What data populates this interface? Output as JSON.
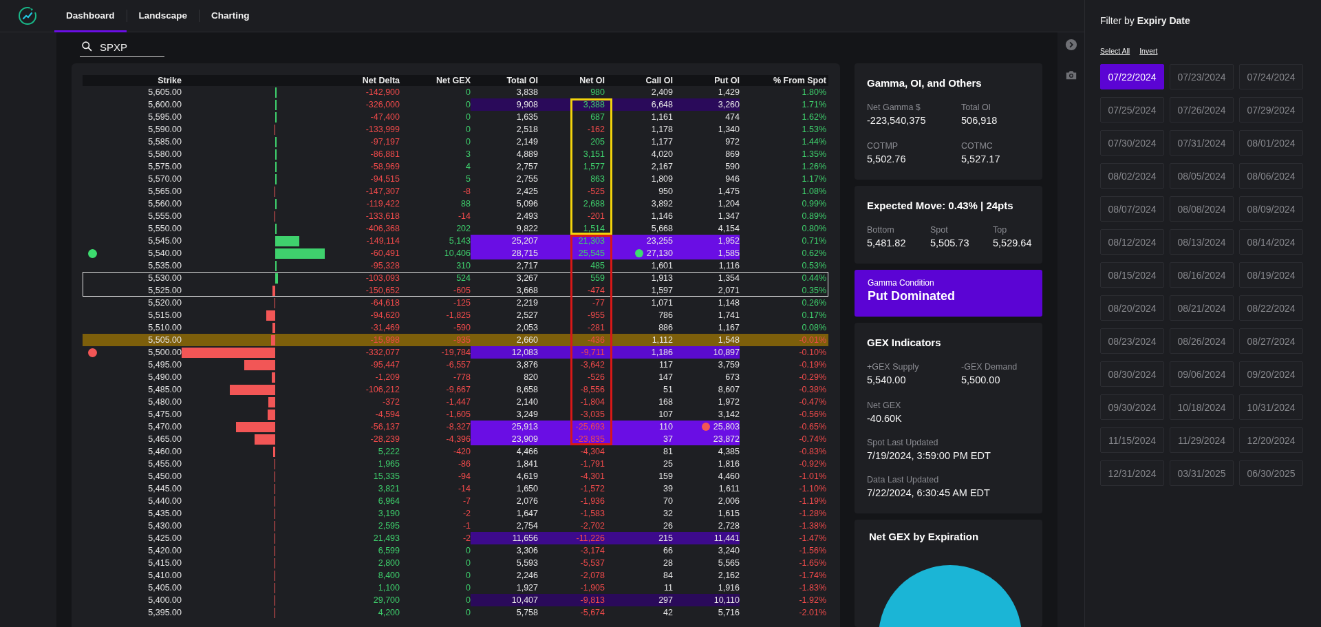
{
  "nav": {
    "tabs": [
      {
        "label": "Dashboard",
        "selected": true
      },
      {
        "label": "Landscape",
        "selected": false
      },
      {
        "label": "Charting",
        "selected": false
      }
    ]
  },
  "search": {
    "value": "SPXP"
  },
  "table": {
    "columns": [
      "Strike",
      "Net Delta",
      "Net GEX",
      "Total OI",
      "Net OI",
      "Call OI",
      "Put OI",
      "% From Spot"
    ],
    "rows": [
      {
        "strike": "5,605.00",
        "net_delta": "-142,900",
        "net_gex": "0",
        "total_oi": "3,838",
        "net_oi": "980",
        "call_oi": "2,409",
        "put_oi": "1,429",
        "from_spot": "1.80%",
        "in_range": false,
        "at_spot": false
      },
      {
        "strike": "5,600.00",
        "net_delta": "-326,000",
        "net_gex": "0",
        "total_oi": "9,908",
        "net_oi": "3,388",
        "call_oi": "6,648",
        "put_oi": "3,260",
        "from_spot": "1.71%",
        "in_range": false,
        "at_spot": false,
        "highlight": {
          "kind": "faint"
        },
        "net_oi_box": {
          "kind": "call"
        }
      },
      {
        "strike": "5,595.00",
        "net_delta": "-47,400",
        "net_gex": "0",
        "total_oi": "1,635",
        "net_oi": "687",
        "call_oi": "1,161",
        "put_oi": "474",
        "from_spot": "1.62%",
        "in_range": false,
        "at_spot": false,
        "net_oi_box": {
          "kind": "call"
        }
      },
      {
        "strike": "5,590.00",
        "net_delta": "-133,999",
        "net_gex": "0",
        "total_oi": "2,518",
        "net_oi": "-162",
        "call_oi": "1,178",
        "put_oi": "1,340",
        "from_spot": "1.53%",
        "in_range": false,
        "at_spot": false,
        "net_oi_box": {
          "kind": "call"
        }
      },
      {
        "strike": "5,585.00",
        "net_delta": "-97,197",
        "net_gex": "0",
        "total_oi": "2,149",
        "net_oi": "205",
        "call_oi": "1,177",
        "put_oi": "972",
        "from_spot": "1.44%",
        "in_range": false,
        "at_spot": false,
        "net_oi_box": {
          "kind": "call"
        }
      },
      {
        "strike": "5,580.00",
        "net_delta": "-86,881",
        "net_gex": "3",
        "total_oi": "4,889",
        "net_oi": "3,151",
        "call_oi": "4,020",
        "put_oi": "869",
        "from_spot": "1.35%",
        "in_range": false,
        "at_spot": false,
        "net_oi_box": {
          "kind": "call"
        }
      },
      {
        "strike": "5,575.00",
        "net_delta": "-58,969",
        "net_gex": "4",
        "total_oi": "2,757",
        "net_oi": "1,577",
        "call_oi": "2,167",
        "put_oi": "590",
        "from_spot": "1.26%",
        "in_range": false,
        "at_spot": false,
        "net_oi_box": {
          "kind": "call"
        }
      },
      {
        "strike": "5,570.00",
        "net_delta": "-94,515",
        "net_gex": "5",
        "total_oi": "2,755",
        "net_oi": "863",
        "call_oi": "1,809",
        "put_oi": "946",
        "from_spot": "1.17%",
        "in_range": false,
        "at_spot": false,
        "net_oi_box": {
          "kind": "call"
        }
      },
      {
        "strike": "5,565.00",
        "net_delta": "-147,307",
        "net_gex": "-8",
        "total_oi": "2,425",
        "net_oi": "-525",
        "call_oi": "950",
        "put_oi": "1,475",
        "from_spot": "1.08%",
        "in_range": false,
        "at_spot": false,
        "net_oi_box": {
          "kind": "call"
        }
      },
      {
        "strike": "5,560.00",
        "net_delta": "-119,422",
        "net_gex": "88",
        "total_oi": "5,096",
        "net_oi": "2,688",
        "call_oi": "3,892",
        "put_oi": "1,204",
        "from_spot": "0.99%",
        "in_range": false,
        "at_spot": false,
        "net_oi_box": {
          "kind": "call"
        }
      },
      {
        "strike": "5,555.00",
        "net_delta": "-133,618",
        "net_gex": "-14",
        "total_oi": "2,493",
        "net_oi": "-201",
        "call_oi": "1,146",
        "put_oi": "1,347",
        "from_spot": "0.89%",
        "in_range": false,
        "at_spot": false,
        "net_oi_box": {
          "kind": "call"
        }
      },
      {
        "strike": "5,550.00",
        "net_delta": "-406,368",
        "net_gex": "202",
        "total_oi": "9,822",
        "net_oi": "1,514",
        "call_oi": "5,668",
        "put_oi": "4,154",
        "from_spot": "0.80%",
        "in_range": false,
        "at_spot": false,
        "net_oi_box": {
          "kind": "call"
        }
      },
      {
        "strike": "5,545.00",
        "net_delta": "-149,114",
        "net_gex": "5,143",
        "total_oi": "25,207",
        "net_oi": "21,303",
        "call_oi": "23,255",
        "put_oi": "1,952",
        "from_spot": "0.71%",
        "in_range": false,
        "at_spot": false,
        "highlight": {
          "kind": "high"
        },
        "net_oi_box": {
          "kind": "put"
        }
      },
      {
        "strike": "5,540.00",
        "net_delta": "-60,491",
        "net_gex": "10,406",
        "total_oi": "28,715",
        "net_oi": "25,545",
        "call_oi": "27,130",
        "put_oi": "1,585",
        "from_spot": "0.62%",
        "in_range": false,
        "at_spot": false,
        "highlight": {
          "kind": "high"
        },
        "net_oi_box": {
          "kind": "put"
        },
        "row_dot": {
          "color": "#3ddc6f"
        },
        "cell_dot": {
          "kind": "call",
          "color": "#3ddc6f"
        }
      },
      {
        "strike": "5,535.00",
        "net_delta": "-95,328",
        "net_gex": "310",
        "total_oi": "2,717",
        "net_oi": "485",
        "call_oi": "1,601",
        "put_oi": "1,116",
        "from_spot": "0.53%",
        "in_range": false,
        "at_spot": false,
        "net_oi_box": {
          "kind": "put"
        }
      },
      {
        "strike": "5,530.00",
        "net_delta": "-103,093",
        "net_gex": "524",
        "total_oi": "3,267",
        "net_oi": "559",
        "call_oi": "1,913",
        "put_oi": "1,354",
        "from_spot": "0.44%",
        "in_range": true,
        "at_spot": false,
        "net_oi_box": {
          "kind": "put"
        }
      },
      {
        "strike": "5,525.00",
        "net_delta": "-150,652",
        "net_gex": "-605",
        "total_oi": "3,668",
        "net_oi": "-474",
        "call_oi": "1,597",
        "put_oi": "2,071",
        "from_spot": "0.35%",
        "in_range": true,
        "at_spot": false,
        "net_oi_box": {
          "kind": "put"
        }
      },
      {
        "strike": "5,520.00",
        "net_delta": "-64,618",
        "net_gex": "-125",
        "total_oi": "2,219",
        "net_oi": "-77",
        "call_oi": "1,071",
        "put_oi": "1,148",
        "from_spot": "0.26%",
        "in_range": false,
        "at_spot": false,
        "net_oi_box": {
          "kind": "put"
        }
      },
      {
        "strike": "5,515.00",
        "net_delta": "-94,620",
        "net_gex": "-1,825",
        "total_oi": "2,527",
        "net_oi": "-955",
        "call_oi": "786",
        "put_oi": "1,741",
        "from_spot": "0.17%",
        "in_range": false,
        "at_spot": false,
        "net_oi_box": {
          "kind": "put"
        }
      },
      {
        "strike": "5,510.00",
        "net_delta": "-31,469",
        "net_gex": "-590",
        "total_oi": "2,053",
        "net_oi": "-281",
        "call_oi": "886",
        "put_oi": "1,167",
        "from_spot": "0.08%",
        "in_range": false,
        "at_spot": false,
        "net_oi_box": {
          "kind": "put"
        }
      },
      {
        "strike": "5,505.00",
        "net_delta": "-15,998",
        "net_gex": "-935",
        "total_oi": "2,660",
        "net_oi": "-436",
        "call_oi": "1,112",
        "put_oi": "1,548",
        "from_spot": "-0.01%",
        "in_range": false,
        "at_spot": true,
        "net_oi_box": {
          "kind": "put"
        }
      },
      {
        "strike": "5,500.00",
        "net_delta": "-332,077",
        "net_gex": "-19,784",
        "total_oi": "12,083",
        "net_oi": "-9,711",
        "call_oi": "1,186",
        "put_oi": "10,897",
        "from_spot": "-0.10%",
        "in_range": false,
        "at_spot": false,
        "highlight": {
          "kind": "medium"
        },
        "net_oi_box": {
          "kind": "put"
        },
        "row_dot": {
          "color": "#f25656"
        }
      },
      {
        "strike": "5,495.00",
        "net_delta": "-95,447",
        "net_gex": "-6,557",
        "total_oi": "3,876",
        "net_oi": "-3,642",
        "call_oi": "117",
        "put_oi": "3,759",
        "from_spot": "-0.19%",
        "in_range": false,
        "at_spot": false,
        "net_oi_box": {
          "kind": "put"
        }
      },
      {
        "strike": "5,490.00",
        "net_delta": "-1,209",
        "net_gex": "-778",
        "total_oi": "820",
        "net_oi": "-526",
        "call_oi": "147",
        "put_oi": "673",
        "from_spot": "-0.29%",
        "in_range": false,
        "at_spot": false,
        "net_oi_box": {
          "kind": "put"
        }
      },
      {
        "strike": "5,485.00",
        "net_delta": "-106,212",
        "net_gex": "-9,667",
        "total_oi": "8,658",
        "net_oi": "-8,556",
        "call_oi": "51",
        "put_oi": "8,607",
        "from_spot": "-0.38%",
        "in_range": false,
        "at_spot": false,
        "net_oi_box": {
          "kind": "put"
        }
      },
      {
        "strike": "5,480.00",
        "net_delta": "-372",
        "net_gex": "-1,447",
        "total_oi": "2,140",
        "net_oi": "-1,804",
        "call_oi": "168",
        "put_oi": "1,972",
        "from_spot": "-0.47%",
        "in_range": false,
        "at_spot": false,
        "net_oi_box": {
          "kind": "put"
        }
      },
      {
        "strike": "5,475.00",
        "net_delta": "-4,594",
        "net_gex": "-1,605",
        "total_oi": "3,249",
        "net_oi": "-3,035",
        "call_oi": "107",
        "put_oi": "3,142",
        "from_spot": "-0.56%",
        "in_range": false,
        "at_spot": false,
        "net_oi_box": {
          "kind": "put"
        }
      },
      {
        "strike": "5,470.00",
        "net_delta": "-56,137",
        "net_gex": "-8,327",
        "total_oi": "25,913",
        "net_oi": "-25,693",
        "call_oi": "110",
        "put_oi": "25,803",
        "from_spot": "-0.65%",
        "in_range": false,
        "at_spot": false,
        "highlight": {
          "kind": "high"
        },
        "net_oi_box": {
          "kind": "put"
        },
        "cell_dot": {
          "kind": "put",
          "color": "#f25656"
        }
      },
      {
        "strike": "5,465.00",
        "net_delta": "-28,239",
        "net_gex": "-4,396",
        "total_oi": "23,909",
        "net_oi": "-23,835",
        "call_oi": "37",
        "put_oi": "23,872",
        "from_spot": "-0.74%",
        "in_range": false,
        "at_spot": false,
        "highlight": {
          "kind": "high"
        },
        "net_oi_box": {
          "kind": "put"
        }
      },
      {
        "strike": "5,460.00",
        "net_delta": "5,222",
        "net_gex": "-420",
        "total_oi": "4,466",
        "net_oi": "-4,304",
        "call_oi": "81",
        "put_oi": "4,385",
        "from_spot": "-0.83%",
        "in_range": false,
        "at_spot": false
      },
      {
        "strike": "5,455.00",
        "net_delta": "1,965",
        "net_gex": "-86",
        "total_oi": "1,841",
        "net_oi": "-1,791",
        "call_oi": "25",
        "put_oi": "1,816",
        "from_spot": "-0.92%",
        "in_range": false,
        "at_spot": false
      },
      {
        "strike": "5,450.00",
        "net_delta": "15,335",
        "net_gex": "-94",
        "total_oi": "4,619",
        "net_oi": "-4,301",
        "call_oi": "159",
        "put_oi": "4,460",
        "from_spot": "-1.01%",
        "in_range": false,
        "at_spot": false
      },
      {
        "strike": "5,445.00",
        "net_delta": "3,821",
        "net_gex": "-14",
        "total_oi": "1,650",
        "net_oi": "-1,572",
        "call_oi": "39",
        "put_oi": "1,611",
        "from_spot": "-1.10%",
        "in_range": false,
        "at_spot": false
      },
      {
        "strike": "5,440.00",
        "net_delta": "6,964",
        "net_gex": "-7",
        "total_oi": "2,076",
        "net_oi": "-1,936",
        "call_oi": "70",
        "put_oi": "2,006",
        "from_spot": "-1.19%",
        "in_range": false,
        "at_spot": false
      },
      {
        "strike": "5,435.00",
        "net_delta": "3,190",
        "net_gex": "-2",
        "total_oi": "1,647",
        "net_oi": "-1,583",
        "call_oi": "32",
        "put_oi": "1,615",
        "from_spot": "-1.28%",
        "in_range": false,
        "at_spot": false
      },
      {
        "strike": "5,430.00",
        "net_delta": "2,595",
        "net_gex": "-1",
        "total_oi": "2,754",
        "net_oi": "-2,702",
        "call_oi": "26",
        "put_oi": "2,728",
        "from_spot": "-1.38%",
        "in_range": false,
        "at_spot": false
      },
      {
        "strike": "5,425.00",
        "net_delta": "21,493",
        "net_gex": "-2",
        "total_oi": "11,656",
        "net_oi": "-11,226",
        "call_oi": "215",
        "put_oi": "11,441",
        "from_spot": "-1.47%",
        "in_range": false,
        "at_spot": false,
        "highlight": {
          "kind": "low"
        }
      },
      {
        "strike": "5,420.00",
        "net_delta": "6,599",
        "net_gex": "0",
        "total_oi": "3,306",
        "net_oi": "-3,174",
        "call_oi": "66",
        "put_oi": "3,240",
        "from_spot": "-1.56%",
        "in_range": false,
        "at_spot": false
      },
      {
        "strike": "5,415.00",
        "net_delta": "2,800",
        "net_gex": "0",
        "total_oi": "5,593",
        "net_oi": "-5,537",
        "call_oi": "28",
        "put_oi": "5,565",
        "from_spot": "-1.65%",
        "in_range": false,
        "at_spot": false
      },
      {
        "strike": "5,410.00",
        "net_delta": "8,400",
        "net_gex": "0",
        "total_oi": "2,246",
        "net_oi": "-2,078",
        "call_oi": "84",
        "put_oi": "2,162",
        "from_spot": "-1.74%",
        "in_range": false,
        "at_spot": false
      },
      {
        "strike": "5,405.00",
        "net_delta": "1,100",
        "net_gex": "0",
        "total_oi": "1,927",
        "net_oi": "-1,905",
        "call_oi": "11",
        "put_oi": "1,916",
        "from_spot": "-1.83%",
        "in_range": false,
        "at_spot": false
      },
      {
        "strike": "5,400.00",
        "net_delta": "29,700",
        "net_gex": "0",
        "total_oi": "10,407",
        "net_oi": "-9,813",
        "call_oi": "297",
        "put_oi": "10,110",
        "from_spot": "-1.92%",
        "in_range": false,
        "at_spot": false,
        "highlight": {
          "kind": "faint"
        }
      },
      {
        "strike": "5,395.00",
        "net_delta": "4,200",
        "net_gex": "0",
        "total_oi": "5,758",
        "net_oi": "-5,674",
        "call_oi": "42",
        "put_oi": "5,716",
        "from_spot": "-2.01%",
        "in_range": false,
        "at_spot": false
      }
    ]
  },
  "gamma_oi": {
    "title": "Gamma, OI, and Others",
    "stats": [
      {
        "label": "Net Gamma $",
        "value": "-223,540,375"
      },
      {
        "label": "Total OI",
        "value": "506,918"
      },
      {
        "label": "COTMP",
        "value": "5,502.76"
      },
      {
        "label": "COTMC",
        "value": "5,527.17"
      }
    ]
  },
  "expected_move": {
    "title": "Expected Move: 0.43% | 24pts",
    "stats": [
      {
        "label": "Bottom",
        "value": "5,481.82"
      },
      {
        "label": "Spot",
        "value": "5,505.73"
      },
      {
        "label": "Top",
        "value": "5,529.64"
      }
    ]
  },
  "gamma_condition": {
    "label": "Gamma Condition",
    "value": "Put Dominated"
  },
  "gex_indicators": {
    "title": "GEX Indicators",
    "stats": [
      {
        "label": "+GEX Supply",
        "value": "5,540.00"
      },
      {
        "label": "-GEX Demand",
        "value": "5,500.00"
      },
      {
        "label": "Net GEX",
        "value": "-40.60K"
      }
    ],
    "updates": [
      {
        "label": "Spot Last Updated",
        "value": "7/19/2024, 3:59:00 PM EDT"
      },
      {
        "label": "Data Last Updated",
        "value": "7/22/2024, 6:30:45 AM EDT"
      }
    ]
  },
  "net_gex_by_expiration": {
    "title": "Net GEX by Expiration"
  },
  "filter": {
    "title": "Filter by **Expiry Date**",
    "actions": [
      "Select All",
      "Invert"
    ],
    "dates": [
      {
        "label": "07/22/2024",
        "selected": true
      },
      {
        "label": "07/23/2024",
        "selected": false
      },
      {
        "label": "07/24/2024",
        "selected": false
      },
      {
        "label": "07/25/2024",
        "selected": false
      },
      {
        "label": "07/26/2024",
        "selected": false
      },
      {
        "label": "07/29/2024",
        "selected": false
      },
      {
        "label": "07/30/2024",
        "selected": false
      },
      {
        "label": "07/31/2024",
        "selected": false
      },
      {
        "label": "08/01/2024",
        "selected": false
      },
      {
        "label": "08/02/2024",
        "selected": false
      },
      {
        "label": "08/05/2024",
        "selected": false
      },
      {
        "label": "08/06/2024",
        "selected": false
      },
      {
        "label": "08/07/2024",
        "selected": false
      },
      {
        "label": "08/08/2024",
        "selected": false
      },
      {
        "label": "08/09/2024",
        "selected": false
      },
      {
        "label": "08/12/2024",
        "selected": false
      },
      {
        "label": "08/13/2024",
        "selected": false
      },
      {
        "label": "08/14/2024",
        "selected": false
      },
      {
        "label": "08/15/2024",
        "selected": false
      },
      {
        "label": "08/16/2024",
        "selected": false
      },
      {
        "label": "08/19/2024",
        "selected": false
      },
      {
        "label": "08/20/2024",
        "selected": false
      },
      {
        "label": "08/21/2024",
        "selected": false
      },
      {
        "label": "08/22/2024",
        "selected": false
      },
      {
        "label": "08/23/2024",
        "selected": false
      },
      {
        "label": "08/26/2024",
        "selected": false
      },
      {
        "label": "08/27/2024",
        "selected": false
      },
      {
        "label": "08/30/2024",
        "selected": false
      },
      {
        "label": "09/06/2024",
        "selected": false
      },
      {
        "label": "09/20/2024",
        "selected": false
      },
      {
        "label": "09/30/2024",
        "selected": false
      },
      {
        "label": "10/18/2024",
        "selected": false
      },
      {
        "label": "10/31/2024",
        "selected": false
      },
      {
        "label": "11/15/2024",
        "selected": false
      },
      {
        "label": "11/29/2024",
        "selected": false
      },
      {
        "label": "12/20/2024",
        "selected": false
      },
      {
        "label": "12/31/2024",
        "selected": false
      },
      {
        "label": "03/31/2025",
        "selected": false
      },
      {
        "label": "06/30/2025",
        "selected": false
      }
    ]
  }
}
